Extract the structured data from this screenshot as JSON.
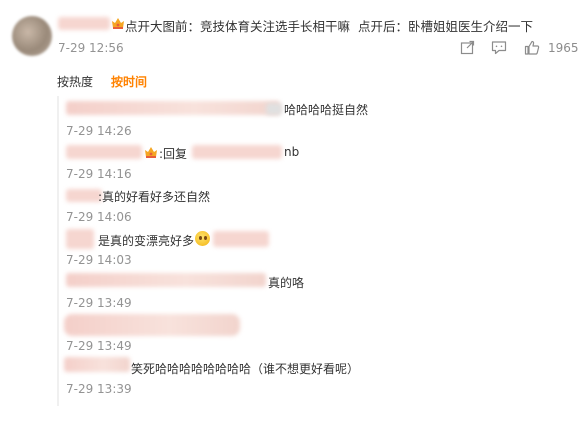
{
  "comment": {
    "text_part1": "点开大图前：竞技体育关注选手长相干嘛",
    "text_part2": "点开后：卧槽姐姐医生介绍一下",
    "time": "7-29 12:56",
    "like_count": "1965",
    "icons": [
      "share-icon",
      "comment-icon",
      "like-icon"
    ]
  },
  "sort_tabs": {
    "hot": "按热度",
    "time": "按时间"
  },
  "replies": [
    {
      "text": "哈哈哈哈挺自然",
      "time": "7-29 14:26"
    },
    {
      "text_prefix": ":回复",
      "text_suffix": "nb",
      "time": "7-29 14:16"
    },
    {
      "text": ":真的好看好多还自然",
      "time": "7-29 14:06"
    },
    {
      "text": "是真的变漂亮好多",
      "time": "7-29 14:03"
    },
    {
      "text": "真的咯",
      "time": "7-29 13:49"
    },
    {
      "text": "",
      "time": "7-29 13:49"
    },
    {
      "text": "笑死哈哈哈哈哈哈哈哈（谁不想更好看呢）",
      "time": "7-29 13:39"
    }
  ],
  "colors": {
    "accent": "#ff8200",
    "meta": "#939393",
    "text": "#333333"
  }
}
